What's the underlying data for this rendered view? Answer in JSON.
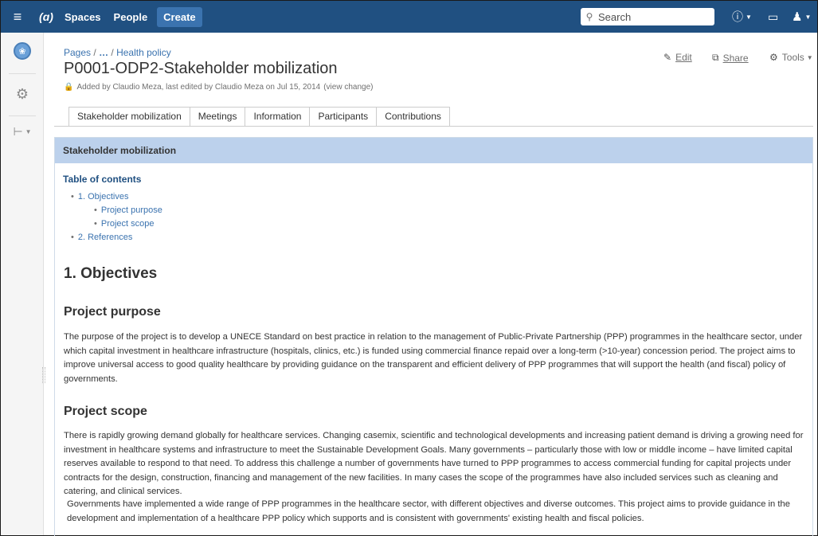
{
  "header": {
    "menu_icon": "hamburger-icon",
    "logo_text": "(ɑ)",
    "nav": [
      "Spaces",
      "People"
    ],
    "create_label": "Create",
    "search_placeholder": "Search",
    "help_icon": "question-circle-icon",
    "notifications_icon": "inbox-icon",
    "user_icon": "user-avatar-icon",
    "brand_color": "#205081"
  },
  "sidebar": {
    "space_logo_icon": "un-emblem-icon",
    "settings_icon": "gear-icon",
    "tree_icon": "page-tree-icon"
  },
  "page": {
    "breadcrumb": [
      "Pages",
      "/",
      "…",
      "/",
      "Health policy"
    ],
    "title": "P0001-ODP2-Stakeholder mobilization",
    "byline": "Added by Claudio Meza, last edited by Claudio Meza on Jul 15, 2014",
    "view_change": "(view change)",
    "actions": {
      "edit": "Edit",
      "share": "Share",
      "tools": "Tools"
    }
  },
  "tabs": [
    "Stakeholder mobilization",
    "Meetings",
    "Information",
    "Participants",
    "Contributions"
  ],
  "active_tab": "Stakeholder mobilization",
  "content": {
    "panel_title": "Stakeholder mobilization",
    "toc_title": "Table of contents",
    "toc": [
      {
        "label": "1. Objectives",
        "level": 1
      },
      {
        "label": "Project purpose",
        "level": 2
      },
      {
        "label": "Project scope",
        "level": 2
      },
      {
        "label": "2. References",
        "level": 1
      }
    ],
    "h1": "1. Objectives",
    "purpose_heading": "Project purpose",
    "purpose_text": "The purpose of the project is to develop a UNECE Standard on best practice in relation to the management of Public-Private Partnership (PPP) programmes in the healthcare sector, under which capital investment in healthcare infrastructure (hospitals, clinics, etc.) is funded using commercial finance repaid over a long-term (>10-year) concession period. The project aims to improve universal access to good quality healthcare by providing guidance on the transparent and efficient delivery of PPP programmes that will support the health (and fiscal) policy of governments.",
    "scope_heading": "Project scope",
    "scope_text_1": "There is rapidly growing demand globally for healthcare services. Changing casemix, scientific and technological developments and increasing patient demand is driving a growing need for investment in healthcare systems and infrastructure to meet the Sustainable Development Goals. Many governments – particularly those with low or middle income – have limited capital reserves available to respond to that need. To address this challenge a number of governments have turned to PPP programmes to access commercial funding for capital projects under contracts for the design, construction, financing and management of the new facilities. In many cases the scope of the programmes have also included services such as cleaning and catering, and clinical services.",
    "scope_text_2": "Governments have implemented a wide range of PPP programmes in the healthcare sector, with different objectives and diverse outcomes. This project aims to provide guidance in the development and implementation of a healthcare PPP policy which supports and is consistent with governments' existing health and fiscal policies."
  }
}
